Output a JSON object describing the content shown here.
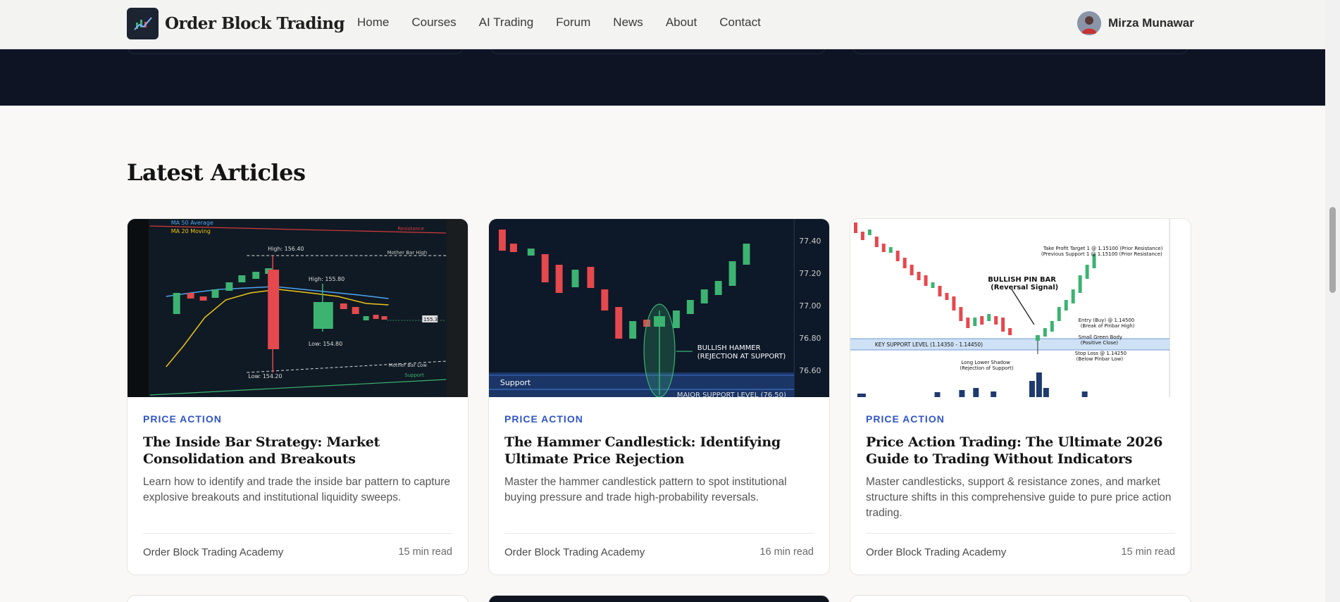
{
  "nav": {
    "brand": "Order Block Trading",
    "links": [
      "Home",
      "Courses",
      "AI Trading",
      "Forum",
      "News",
      "About",
      "Contact"
    ],
    "user": "Mirza Munawar"
  },
  "section_title": "Latest Articles",
  "articles": [
    {
      "category": "PRICE ACTION",
      "title": "The Inside Bar Strategy: Market Consolidation and Breakouts",
      "excerpt": "Learn how to identify and trade the inside bar pattern to capture explosive breakouts and institutional liquidity sweeps.",
      "author": "Order Block Trading Academy",
      "read_time": "15 min read",
      "image": {
        "labels": [
          "MA 50 Average",
          "MA 20 Moving",
          "Resistance",
          "High: 156.40",
          "High: 155.80",
          "Low: 154.80",
          "Low: 154.20",
          "Mother Bar High",
          "Mother Bar Low",
          "Support",
          "155.32"
        ]
      }
    },
    {
      "category": "PRICE ACTION",
      "title": "The Hammer Candlestick: Identifying Ultimate Price Rejection",
      "excerpt": "Master the hammer candlestick pattern to spot institutional buying pressure and trade high-probability reversals.",
      "author": "Order Block Trading Academy",
      "read_time": "16 min read",
      "image": {
        "axis": [
          "77.40",
          "77.20",
          "77.00",
          "76.80",
          "76.60"
        ],
        "callout_1": "BULLISH HAMMER",
        "callout_2": "(REJECTION AT SUPPORT)",
        "support": "Support",
        "major_support": "MAJOR SUPPORT LEVEL (76.50)"
      }
    },
    {
      "category": "PRICE ACTION",
      "title": "Price Action Trading: The Ultimate 2026 Guide to Trading Without Indicators",
      "excerpt": "Master candlesticks, support & resistance zones, and market structure shifts in this comprehensive guide to pure price action trading.",
      "author": "Order Block Trading Academy",
      "read_time": "15 min read",
      "image": {
        "pin_bar_1": "BULLISH PIN BAR",
        "pin_bar_2": "(Reversal Signal)",
        "tp_1": "Take Profit Target 1 @ 1.15100 (Prior Resistance)",
        "tp_2": "(Previous Support 1 @ 1.15100 (Prior Resistance)",
        "entry_1": "Entry (Buy) @ 1.14500",
        "entry_2": "(Break of Pinbar High)",
        "body_1": "Small Green Body",
        "body_2": "(Positive Close)",
        "key_support": "KEY SUPPORT LEVEL (1.14350 - 1.14450)",
        "stop_1": "Stop Loss @ 1.14250",
        "stop_2": "(Below Pinbar Low)",
        "shadow_1": "Long Lower Shadow",
        "shadow_2": "(Rejection of Support)"
      }
    }
  ],
  "colors": {
    "accent_blue": "#2f55c7",
    "bull_green": "#3cb371",
    "bear_red": "#e5484d",
    "dark_band": "#0e1424"
  }
}
